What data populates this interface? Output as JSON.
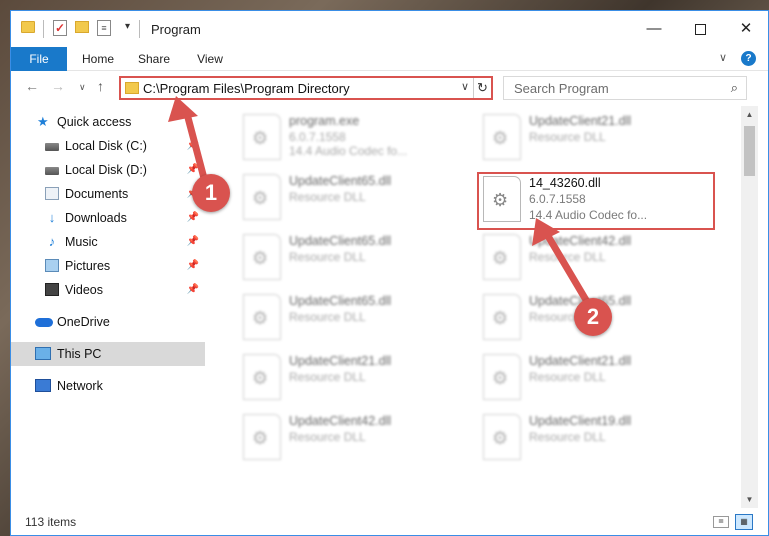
{
  "window": {
    "title": "Program",
    "minimize_glyph": "—",
    "close_glyph": "✕"
  },
  "ribbon": {
    "tabs": [
      "File",
      "Home",
      "Share",
      "View"
    ],
    "collapse_glyph": "∨",
    "help_glyph": "?"
  },
  "nav": {
    "back_glyph": "←",
    "forward_glyph": "→",
    "recent_glyph": "∨",
    "up_glyph": "↑",
    "address": "C:\\Program Files\\Program Directory",
    "address_dropdown_glyph": "∨",
    "refresh_glyph": "↻",
    "search_placeholder": "Search Program",
    "search_glyph": "⌕"
  },
  "sidebar": {
    "items": [
      {
        "label": "Quick access",
        "icon": "star-icon"
      },
      {
        "label": "Local Disk (C:)",
        "icon": "drive-icon"
      },
      {
        "label": "Local Disk (D:)",
        "icon": "drive-icon"
      },
      {
        "label": "Documents",
        "icon": "documents-icon"
      },
      {
        "label": "Downloads",
        "icon": "downloads-icon"
      },
      {
        "label": "Music",
        "icon": "music-icon"
      },
      {
        "label": "Pictures",
        "icon": "pictures-icon"
      },
      {
        "label": "Videos",
        "icon": "videos-icon"
      },
      {
        "label": "OneDrive",
        "icon": "onedrive-icon"
      },
      {
        "label": "This PC",
        "icon": "this-pc-icon",
        "selected": true
      },
      {
        "label": "Network",
        "icon": "network-icon"
      }
    ],
    "pin_glyph": "📌",
    "star_glyph": "★",
    "download_glyph": "↓",
    "music_glyph": "♪"
  },
  "files": [
    {
      "name": "program.exe",
      "line2": "6.0.7.1558",
      "line3": "14.4 Audio Codec fo...",
      "kind": "exe"
    },
    {
      "name": "UpdateClient21.dll",
      "line2": "Resource DLL"
    },
    {
      "name": "UpdateClient65.dll",
      "line2": "Resource DLL"
    },
    {
      "name": "14_43260.dll",
      "line2": "6.0.7.1558",
      "line3": "14.4 Audio Codec fo...",
      "highlighted": true
    },
    {
      "name": "UpdateClient65.dll",
      "line2": "Resource DLL"
    },
    {
      "name": "UpdateClient42.dll",
      "line2": "Resource DLL"
    },
    {
      "name": "UpdateClient65.dll",
      "line2": "Resource DLL"
    },
    {
      "name": "UpdateClient65.dll",
      "line2": "Resource DLL"
    },
    {
      "name": "UpdateClient21.dll",
      "line2": "Resource DLL"
    },
    {
      "name": "UpdateClient21.dll",
      "line2": "Resource DLL"
    },
    {
      "name": "UpdateClient42.dll",
      "line2": "Resource DLL"
    },
    {
      "name": "UpdateClient19.dll",
      "line2": "Resource DLL"
    }
  ],
  "gear_glyph": "⚙",
  "status": {
    "item_count": "113 items"
  },
  "annotations": {
    "badge1": "1",
    "badge2": "2",
    "color": "#d9534f"
  },
  "scroll": {
    "up_glyph": "▲",
    "down_glyph": "▼"
  }
}
